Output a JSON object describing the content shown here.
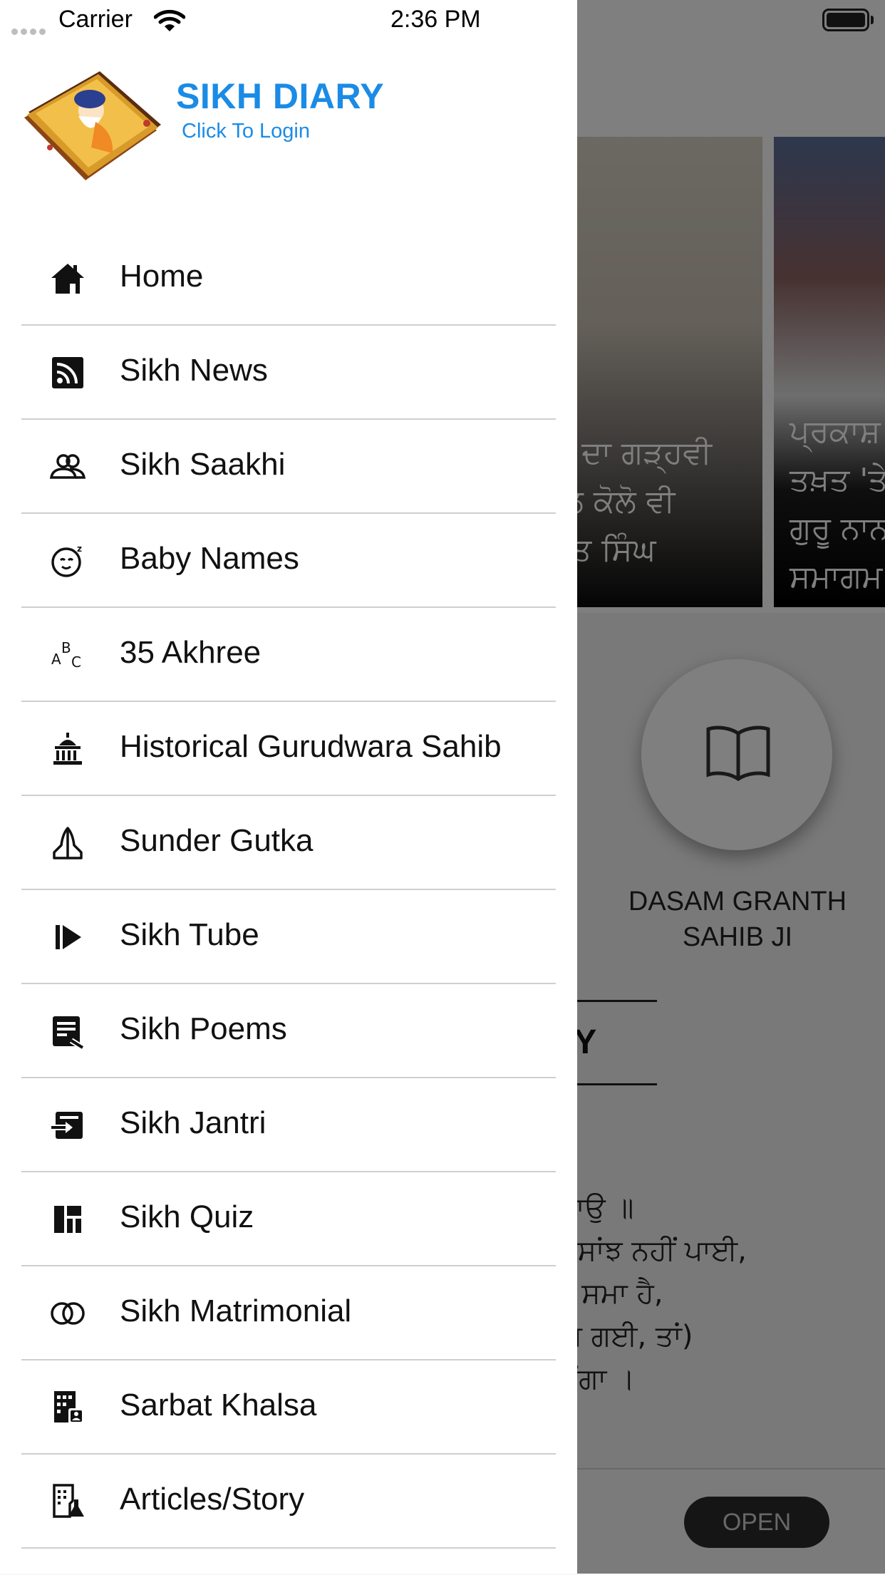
{
  "status_bar": {
    "carrier": "Carrier",
    "time": "2:36 PM"
  },
  "drawer": {
    "app_title": "SIKH DIARY",
    "login_link": "Click To Login",
    "menu": [
      {
        "label": "Home",
        "icon": "home-icon"
      },
      {
        "label": "Sikh News",
        "icon": "rss-icon"
      },
      {
        "label": "Sikh Saakhi",
        "icon": "people-icon"
      },
      {
        "label": "Baby Names",
        "icon": "baby-icon"
      },
      {
        "label": "35 Akhree",
        "icon": "abc-icon"
      },
      {
        "label": "Historical Gurudwara Sahib",
        "icon": "building-icon"
      },
      {
        "label": "Sunder Gutka",
        "icon": "prayer-hands-icon"
      },
      {
        "label": "Sikh Tube",
        "icon": "play-icon"
      },
      {
        "label": "Sikh Poems",
        "icon": "document-edit-icon"
      },
      {
        "label": "Sikh Jantri",
        "icon": "calendar-arrow-icon"
      },
      {
        "label": "Sikh Quiz",
        "icon": "dashboard-icon"
      },
      {
        "label": "Sikh Matrimonial",
        "icon": "rings-icon"
      },
      {
        "label": "Sarbat Khalsa",
        "icon": "office-building-icon"
      },
      {
        "label": "Articles/Story",
        "icon": "article-flask-icon"
      }
    ]
  },
  "background": {
    "news_card_1_text": [
      "ਲਾਂ ਦਾ ਗੜ੍ਹਵੀ",
      "ਦਲ ਕੋਲੋ ਵੀ",
      "ਜੀਤ ਸਿੰਘ"
    ],
    "news_card_2_text": [
      "ਪ੍ਰਕਾਸ਼ ਪੁ",
      "ਤਖ਼ਤ 'ਤੇ",
      "ਗੁਰੂ ਨਾਨ",
      "ਸਮਾਗਮ"
    ],
    "dasam_label": "DASAM GRANTH SAHIB JI",
    "today_heading": "AY",
    "gurbani_lines": [
      "॥",
      "ਰਹਾਉ ॥",
      "ਪੀ ਸਾਂਝ ਨਹੀਂ ਪਾਈ,",
      "ਾ ਸਮਾ ਹੈ,",
      "ਲੰਘ ਗਈ, ਤਾਂ)",
      "ਕਰੇਂਗਾ ।"
    ],
    "open_button": "OPEN"
  }
}
